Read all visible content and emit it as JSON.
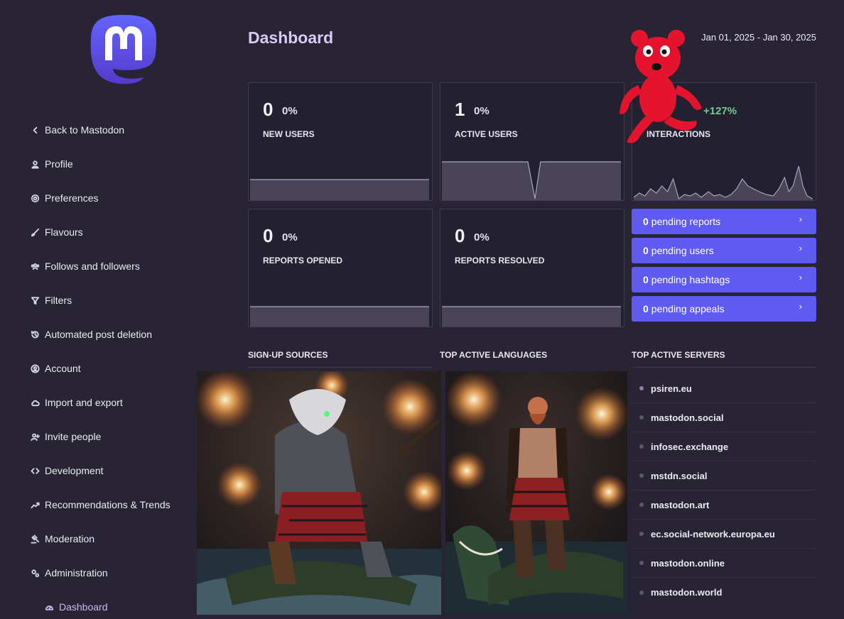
{
  "nav": {
    "back": "Back to Mastodon",
    "items": [
      {
        "label": "Profile",
        "icon": "user-icon"
      },
      {
        "label": "Preferences",
        "icon": "gear-icon"
      },
      {
        "label": "Flavours",
        "icon": "brush-icon"
      },
      {
        "label": "Follows and followers",
        "icon": "users-icon"
      },
      {
        "label": "Filters",
        "icon": "filter-icon"
      },
      {
        "label": "Automated post deletion",
        "icon": "history-icon"
      },
      {
        "label": "Account",
        "icon": "user-circle-icon"
      },
      {
        "label": "Import and export",
        "icon": "cloud-icon"
      },
      {
        "label": "Invite people",
        "icon": "user-plus-icon"
      },
      {
        "label": "Development",
        "icon": "code-icon"
      },
      {
        "label": "Recommendations & Trends",
        "icon": "chart-line-icon"
      },
      {
        "label": "Moderation",
        "icon": "gavel-icon"
      },
      {
        "label": "Administration",
        "icon": "cogs-icon"
      }
    ],
    "sub": "Dashboard"
  },
  "header": {
    "title": "Dashboard",
    "range": "Jan 01, 2025 - Jan 30, 2025"
  },
  "metrics": {
    "new_users": {
      "value": "0",
      "change": "0%",
      "label": "NEW USERS"
    },
    "active_users": {
      "value": "1",
      "change": "0%",
      "label": "ACTIVE USERS"
    },
    "interactions": {
      "change": "+127%",
      "label": "INTERACTIONS"
    },
    "reports_opened": {
      "value": "0",
      "change": "0%",
      "label": "REPORTS OPENED"
    },
    "reports_resolved": {
      "value": "0",
      "change": "0%",
      "label": "REPORTS RESOLVED"
    }
  },
  "pending": [
    {
      "count": "0",
      "label": "pending reports"
    },
    {
      "count": "0",
      "label": "pending users"
    },
    {
      "count": "0",
      "label": "pending hashtags"
    },
    {
      "count": "0",
      "label": "pending appeals"
    }
  ],
  "sections": {
    "signup": "SIGN-UP SOURCES",
    "languages": "TOP ACTIVE LANGUAGES",
    "servers": "TOP ACTIVE SERVERS"
  },
  "servers": [
    "psiren.eu",
    "mastodon.social",
    "infosec.exchange",
    "mstdn.social",
    "mastodon.art",
    "ec.social-network.europa.eu",
    "mastodon.online",
    "mastodon.world"
  ],
  "colors": {
    "accent": "#5f5af2",
    "positive": "#79c891",
    "bg": "#282433"
  }
}
